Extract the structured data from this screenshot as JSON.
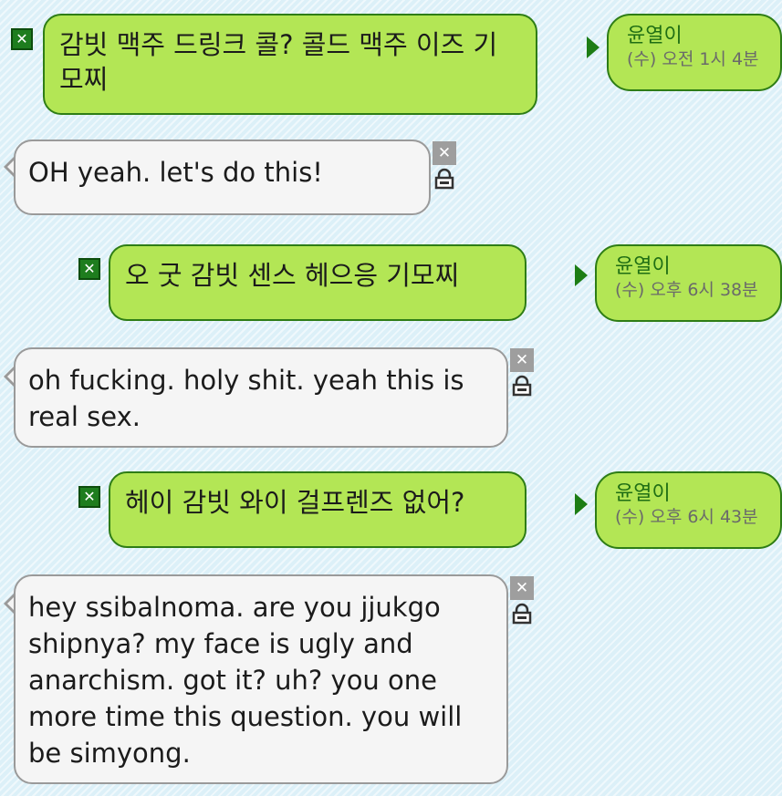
{
  "messages": [
    {
      "direction": "outgoing",
      "text": "감빗 맥주 드링크 콜? 콜드 맥주 이즈 기모찌",
      "sender": "윤열이",
      "time": "(수) 오전 1시 4분"
    },
    {
      "direction": "incoming",
      "text": "OH yeah. let's do this!"
    },
    {
      "direction": "outgoing",
      "text": "오 굿 감빗 센스 헤으응 기모찌",
      "sender": "윤열이",
      "time": "(수) 오후 6시 38분"
    },
    {
      "direction": "incoming",
      "text": "oh fucking. holy shit. yeah this is real sex."
    },
    {
      "direction": "outgoing",
      "text": "헤이 감빗 와이 걸프렌즈 없어?",
      "sender": "윤열이",
      "time": "(수) 오후 6시 43분"
    },
    {
      "direction": "incoming",
      "text": "hey ssibalnoma. are you jjukgo shipnya? my face is ugly and anarchism. got it? uh? you one more time this question. you will be simyong."
    }
  ],
  "icons": {
    "delete": "✕",
    "send_arrow": "play-arrow-icon",
    "lock": "lock-icon"
  },
  "colors": {
    "outgoing_bubble": "#b3e655",
    "outgoing_border": "#2e7d16",
    "incoming_bubble": "#f5f5f5",
    "incoming_border": "#9a9a9a",
    "sender_name": "#1f6e14",
    "background": "#dcf0f8"
  }
}
